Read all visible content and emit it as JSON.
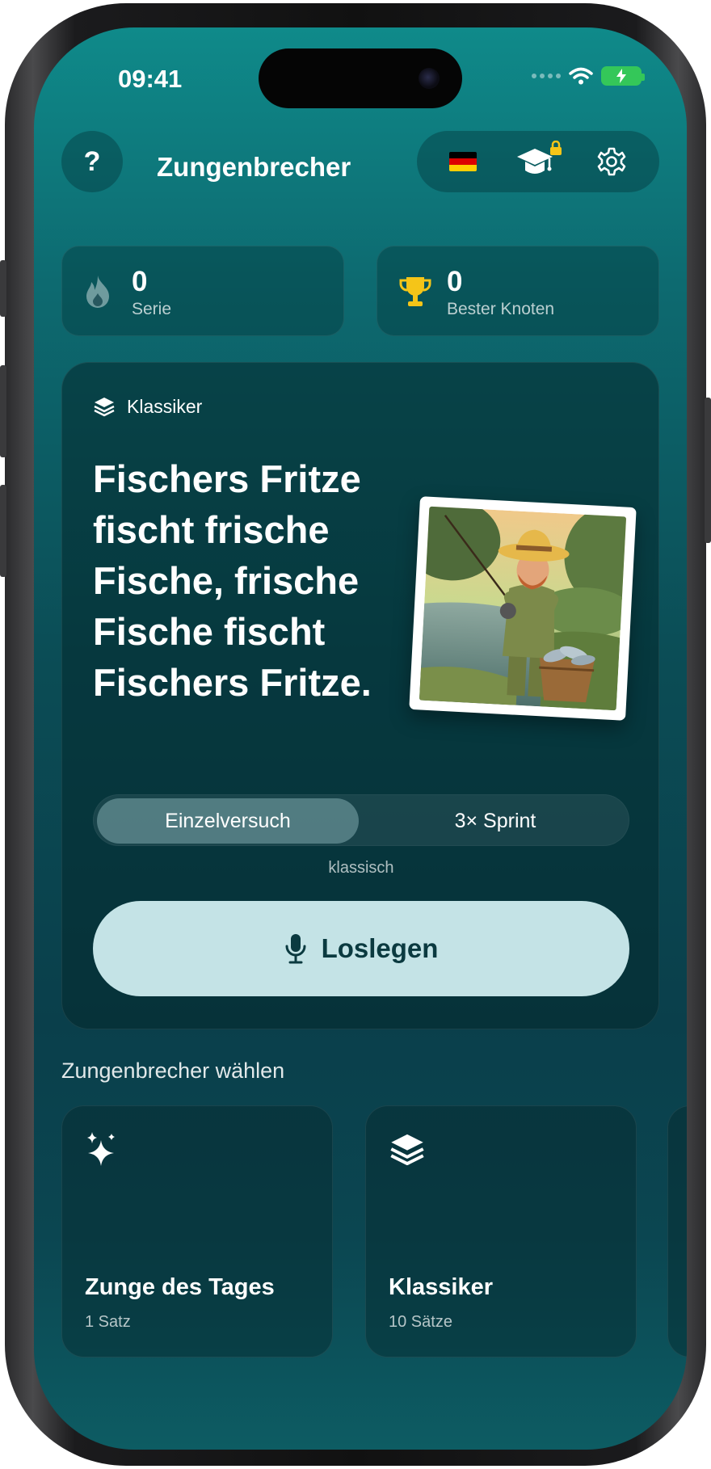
{
  "status_bar": {
    "time": "09:41"
  },
  "header": {
    "help_label": "?",
    "title": "Zungenbrecher",
    "language": "de",
    "icons": [
      "flag-germany-icon",
      "graduation-cap-icon",
      "lock-icon",
      "gear-icon"
    ]
  },
  "stats": [
    {
      "value": "0",
      "label": "Serie",
      "icon": "flame-icon"
    },
    {
      "value": "0",
      "label": "Bester Knoten",
      "icon": "trophy-icon"
    }
  ],
  "featured": {
    "category": "Klassiker",
    "text": "Fischers Fritze fischt frische Fische, frische Fische fischt Fischers Fritze.",
    "image_icon": "fisherman-illustration",
    "modes": [
      {
        "label": "Einzelversuch",
        "selected": true
      },
      {
        "label": "3× Sprint",
        "selected": false
      }
    ],
    "mode_caption": "klassisch",
    "start_label": "Loslegen"
  },
  "picker": {
    "title": "Zungenbrecher wählen",
    "cards": [
      {
        "title": "Zunge des Tages",
        "subtitle": "1 Satz",
        "icon": "sparkles-icon"
      },
      {
        "title": "Klassiker",
        "subtitle": "10 Sätze",
        "icon": "layers-icon"
      }
    ]
  },
  "colors": {
    "background_top": "#0f8a8a",
    "background_bottom": "#0a3f4b",
    "button_bg": "#c4e3e6",
    "button_text": "#0b3a40",
    "trophy": "#f5c518",
    "battery": "#34c759"
  }
}
